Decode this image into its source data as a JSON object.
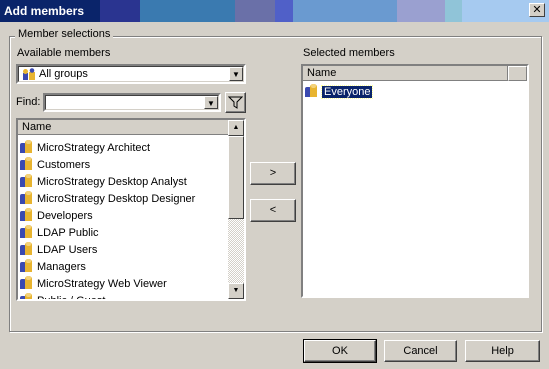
{
  "window": {
    "title": "Add members",
    "close_glyph": "✕"
  },
  "group": {
    "label": "Member selections"
  },
  "available": {
    "label": "Available members",
    "groups_combo_value": "All groups",
    "find_label": "Find:",
    "find_value": "",
    "filter_icon": "funnel-icon",
    "column_header": "Name",
    "items": [
      "MicroStrategy Architect",
      "Customers",
      "MicroStrategy Desktop Analyst",
      "MicroStrategy Desktop Designer",
      "Developers",
      "LDAP Public",
      "LDAP Users",
      "Managers",
      "MicroStrategy Web Viewer",
      "Public / Guest"
    ]
  },
  "transfer": {
    "add_label": ">",
    "remove_label": "<"
  },
  "selected": {
    "label": "Selected members",
    "column_header": "Name",
    "items": [
      "Everyone"
    ]
  },
  "footer": {
    "ok_label": "OK",
    "cancel_label": "Cancel",
    "help_label": "Help"
  },
  "colors": {
    "title_start": "#0a246a",
    "selection": "#0a246a",
    "face": "#d4d0c8"
  }
}
